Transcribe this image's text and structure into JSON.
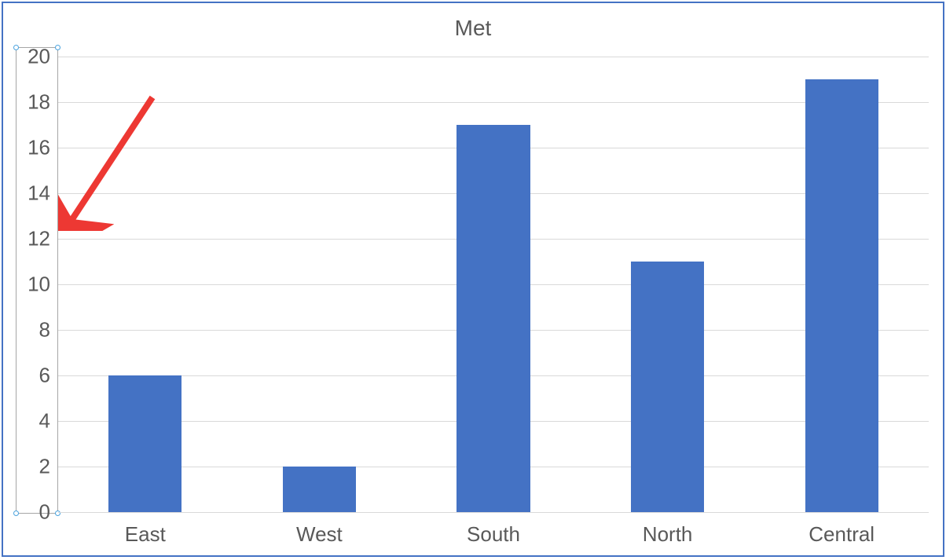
{
  "chart_data": {
    "type": "bar",
    "title": "Met",
    "categories": [
      "East",
      "West",
      "South",
      "North",
      "Central"
    ],
    "values": [
      6,
      2,
      17,
      11,
      19
    ],
    "xlabel": "",
    "ylabel": "",
    "ylim": [
      0,
      20
    ],
    "yticks": [
      0,
      2,
      4,
      6,
      8,
      10,
      12,
      14,
      16,
      18,
      20
    ],
    "bar_color": "#4472C4",
    "grid": true
  },
  "annotation": {
    "type": "arrow",
    "color": "#ED3833",
    "target": "y-axis"
  },
  "selection": {
    "element": "y-axis",
    "selected": true
  }
}
